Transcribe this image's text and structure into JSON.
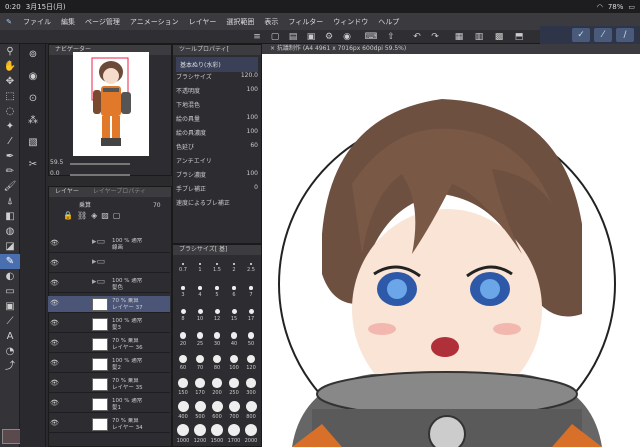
{
  "status": {
    "time": "0:20",
    "date": "3月15日(月)",
    "battery": "78%"
  },
  "menu": [
    "ファイル",
    "編集",
    "ページ管理",
    "アニメーション",
    "レイヤー",
    "選択範囲",
    "表示",
    "フィルター",
    "ウィンドウ",
    "ヘルプ"
  ],
  "panels": {
    "navigator": "ナビゲーター",
    "tool_property": "ツールプロパティ[",
    "layer": "レイヤー",
    "layer_property": "レイヤープロパティ",
    "brush_size": "ブラシサイズ[ 基]"
  },
  "navigator": {
    "zoom": "59.5",
    "angle": "0.0"
  },
  "tool_property": {
    "brush_name": "基本ぬり(水彩)",
    "rows": [
      {
        "label": "ブラシサイズ",
        "value": "120.0"
      },
      {
        "label": "不透明度",
        "value": "100"
      },
      {
        "label": "下地混色",
        "value": ""
      },
      {
        "label": "絵の具量",
        "value": "100"
      },
      {
        "label": "絵の具濃度",
        "value": "100"
      },
      {
        "label": "色延び",
        "value": "60"
      },
      {
        "label": "アンチエイリ",
        "value": ""
      },
      {
        "label": "ブラシ濃度",
        "value": "100"
      },
      {
        "label": "手ブレ補正",
        "value": "0"
      },
      {
        "label": "速度によるブレ補正",
        "value": ""
      }
    ]
  },
  "layers": {
    "blend_mode": "乗算",
    "opacity": "70",
    "rows": [
      {
        "l1": "100 % 通常",
        "l2": "線画",
        "type": "folder"
      },
      {
        "l1": "",
        "l2": "",
        "type": "folder"
      },
      {
        "l1": "100 % 通常",
        "l2": "髪色",
        "type": "folder"
      },
      {
        "l1": "70 % 乗算",
        "l2": "レイヤー 37",
        "type": "layer",
        "sel": true
      },
      {
        "l1": "100 % 通常",
        "l2": "髪3",
        "type": "layer"
      },
      {
        "l1": "70 % 乗算",
        "l2": "レイヤー 36",
        "type": "layer"
      },
      {
        "l1": "100 % 通常",
        "l2": "髪2",
        "type": "layer"
      },
      {
        "l1": "70 % 乗算",
        "l2": "レイヤー 35",
        "type": "layer"
      },
      {
        "l1": "100 % 通常",
        "l2": "髪1",
        "type": "layer"
      },
      {
        "l1": "70 % 乗算",
        "l2": "レイヤー 34",
        "type": "layer"
      }
    ]
  },
  "brush_sizes": [
    "0.7",
    "1",
    "1.5",
    "2",
    "2.5",
    "3",
    "4",
    "5",
    "6",
    "7",
    "8",
    "10",
    "12",
    "15",
    "17",
    "20",
    "25",
    "30",
    "40",
    "50",
    "60",
    "70",
    "80",
    "100",
    "120",
    "150",
    "170",
    "200",
    "250",
    "300",
    "400",
    "500",
    "600",
    "700",
    "800",
    "1000",
    "1200",
    "1500",
    "1700",
    "2000"
  ],
  "canvas_title": "× 抗議制作 (A4 4961 x 7016px 600dpi 59.5%)",
  "colors": {
    "accent": "#4a6fb0",
    "panel": "#2c2c31",
    "bg": "#2b2b2e"
  }
}
